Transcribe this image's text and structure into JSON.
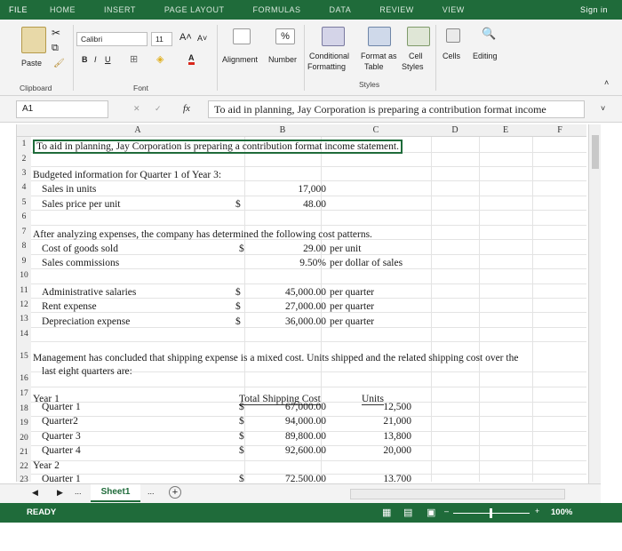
{
  "ribbon": {
    "tabs": [
      "FILE",
      "HOME",
      "INSERT",
      "PAGE LAYOUT",
      "FORMULAS",
      "DATA",
      "REVIEW",
      "VIEW"
    ],
    "sign_in": "Sign in",
    "paste": "Paste",
    "clipboard": "Clipboard",
    "font_name": "Calibri",
    "font_size": "11",
    "font_group": "Font",
    "alignment": "Alignment",
    "number": "Number",
    "percent": "%",
    "conditional_formatting_1": "Conditional",
    "conditional_formatting_2": "Formatting",
    "format_as_table_1": "Format as",
    "format_as_table_2": "Table",
    "cell_styles_1": "Cell",
    "cell_styles_2": "Styles",
    "styles_group": "Styles",
    "cells": "Cells",
    "editing": "Editing",
    "bold": "B",
    "italic": "I",
    "underline": "U"
  },
  "formula_bar": {
    "name_box": "A1",
    "fx": "fx",
    "content": "To aid in planning, Jay Corporation is preparing a contribution format income"
  },
  "columns": [
    "A",
    "B",
    "C",
    "D",
    "E",
    "F"
  ],
  "rows": {
    "r1": "To aid in planning, Jay Corporation is preparing a contribution format income statement.",
    "r3": "Budgeted information for Quarter 1 of Year 3:",
    "r4a": "Sales in units",
    "r4c": "17,000",
    "r5a": "Sales price per unit",
    "r5b": "$",
    "r5c": "48.00",
    "r7": "After analyzing expenses, the company has determined the following cost patterns.",
    "r8a": "Cost of goods sold",
    "r8b": "$",
    "r8c": "29.00",
    "r8d": "per unit",
    "r9a": "Sales commissions",
    "r9c": "9.50%",
    "r9d": "per dollar of sales",
    "r11a": "Administrative salaries",
    "r11b": "$",
    "r11c": "45,000.00",
    "r11d": "per quarter",
    "r12a": "Rent expense",
    "r12b": "$",
    "r12c": "27,000.00",
    "r12d": "per quarter",
    "r13a": "Depreciation expense",
    "r13b": "$",
    "r13c": "36,000.00",
    "r13d": "per quarter",
    "r15a": "Management has concluded that shipping expense is a mixed cost. Units shipped and the related shipping cost over the",
    "r15b": "last eight quarters are:",
    "r17a": "Year 1",
    "r17c": "Total Shipping Cost",
    "r17d": "Units",
    "q_rows": [
      {
        "label": "Quarter 1",
        "dollar": "$",
        "cost": "67,000.00",
        "units": "12,500"
      },
      {
        "label": "Quarter2",
        "dollar": "$",
        "cost": "94,000.00",
        "units": "21,000"
      },
      {
        "label": "Quarter 3",
        "dollar": "$",
        "cost": "89,800.00",
        "units": "13,800"
      },
      {
        "label": "Quarter 4",
        "dollar": "$",
        "cost": "92,600.00",
        "units": "20,000"
      }
    ],
    "r22a": "Year 2",
    "r23a": "Quarter 1",
    "r23b": "$",
    "r23c": "72,500.00",
    "r23d": "13,700"
  },
  "row_numbers": [
    "1",
    "2",
    "3",
    "4",
    "5",
    "6",
    "7",
    "8",
    "9",
    "10",
    "11",
    "12",
    "13",
    "14",
    "15",
    "16",
    "17",
    "18",
    "19",
    "20",
    "21",
    "22",
    "23"
  ],
  "sheet_tabs": {
    "active": "Sheet1",
    "ellipsis_left": "...",
    "ellipsis_right": "..."
  },
  "status": {
    "ready": "READY",
    "zoom": "100%"
  },
  "colors": {
    "accent": "#1f6b3a"
  }
}
